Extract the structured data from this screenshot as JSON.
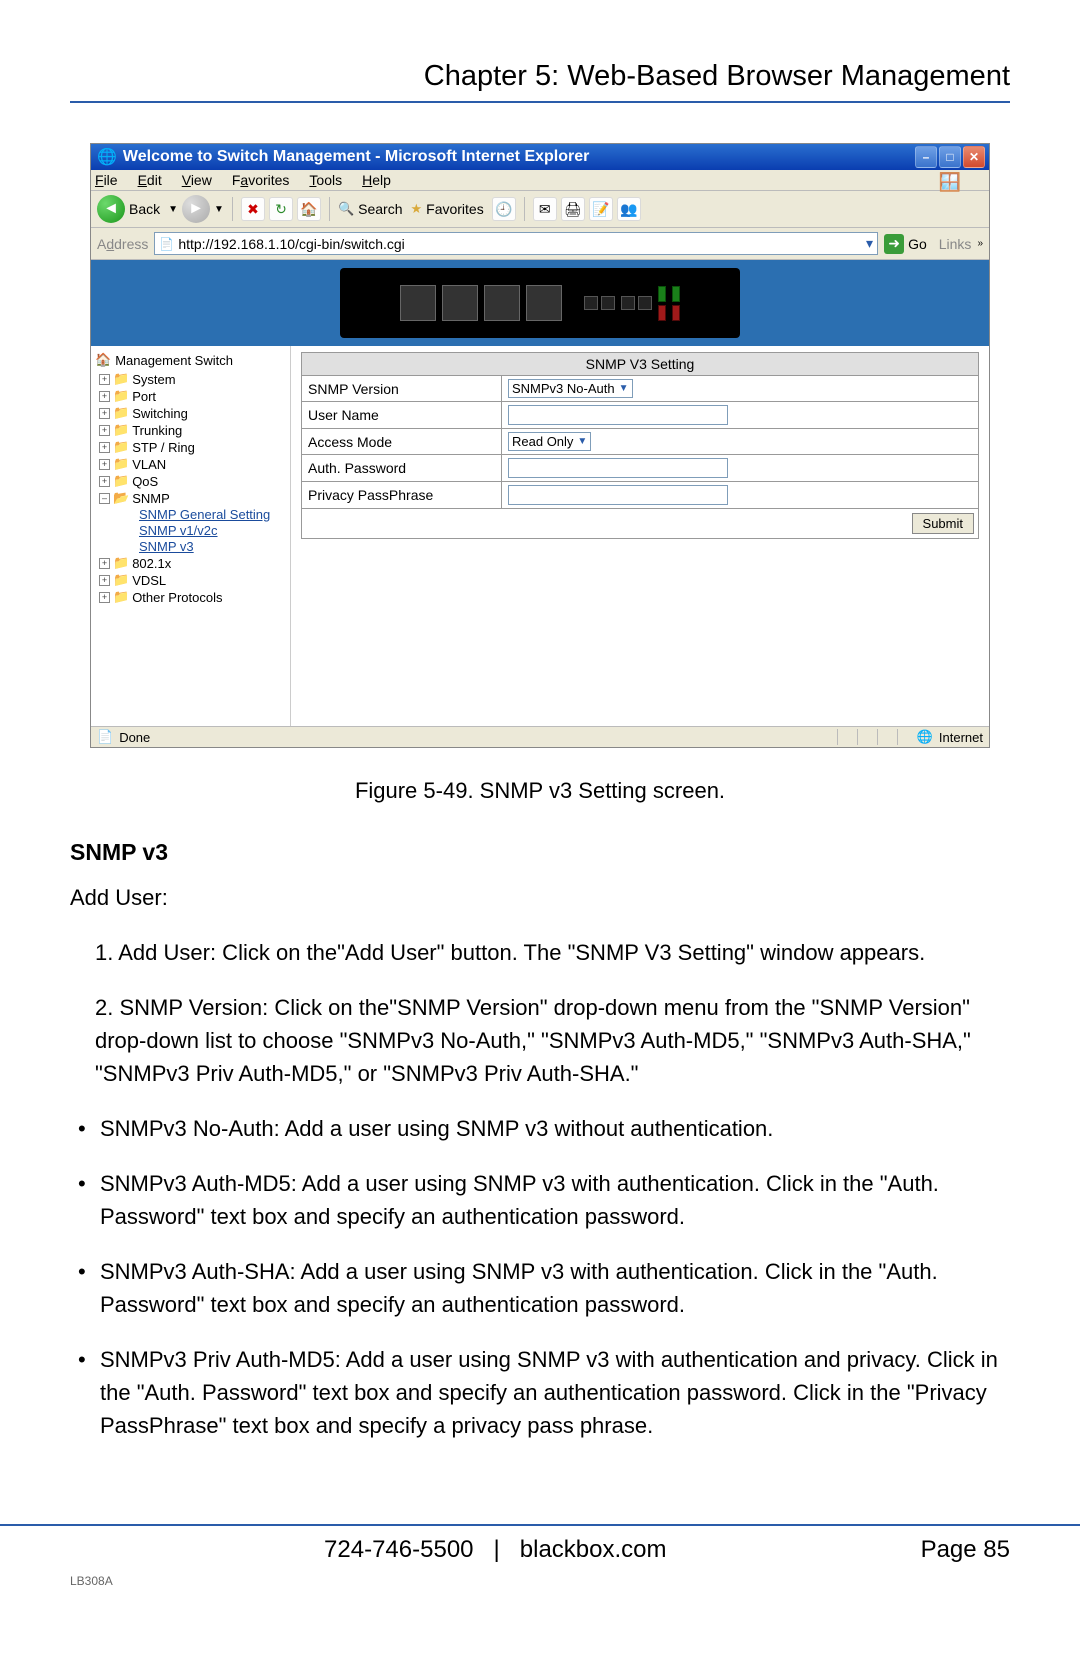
{
  "chapter_title": "Chapter 5: Web-Based Browser Management",
  "browser": {
    "title": "Welcome to Switch Management - Microsoft Internet Explorer",
    "menu": [
      "File",
      "Edit",
      "View",
      "Favorites",
      "Tools",
      "Help"
    ],
    "back_label": "Back",
    "search_label": "Search",
    "favorites_label": "Favorites",
    "address_label": "Address",
    "url": "http://192.168.1.10/cgi-bin/switch.cgi",
    "go_label": "Go",
    "links_label": "Links",
    "status_done": "Done",
    "status_zone": "Internet"
  },
  "tree": {
    "root": "Management Switch",
    "items": [
      "System",
      "Port",
      "Switching",
      "Trunking",
      "STP / Ring",
      "VLAN",
      "QoS"
    ],
    "snmp": "SNMP",
    "snmp_children": [
      "SNMP General Setting",
      "SNMP v1/v2c",
      "SNMP v3"
    ],
    "items_after": [
      "802.1x",
      "VDSL",
      "Other Protocols"
    ]
  },
  "form": {
    "heading": "SNMP V3 Setting",
    "rows": {
      "snmp_version": "SNMP Version",
      "snmp_version_value": "SNMPv3 No-Auth",
      "user_name": "User Name",
      "access_mode": "Access Mode",
      "access_mode_value": "Read Only",
      "auth_password": "Auth. Password",
      "privacy_passphrase": "Privacy PassPhrase"
    },
    "submit": "Submit"
  },
  "figure_caption": "Figure 5-49. SNMP v3 Setting screen.",
  "section_heading": "SNMP v3",
  "add_user_label": "Add User:",
  "step1": "1. Add User: Click on the\"Add User\" button. The \"SNMP V3 Setting\" window appears.",
  "step2": "2. SNMP Version: Click on the\"SNMP Version\" drop-down menu from the \"SNMP Version\" drop-down list to choose \"SNMPv3 No-Auth,\" \"SNMPv3 Auth-MD5,\" \"SNMPv3 Auth-SHA,\" \"SNMPv3 Priv Auth-MD5,\" or \"SNMPv3 Priv Auth-SHA.\"",
  "bullet1": "SNMPv3 No-Auth: Add a user using SNMP v3 without authentication.",
  "bullet2": "SNMPv3 Auth-MD5: Add a user using SNMP v3 with authentication. Click in the \"Auth. Password\" text box and specify an authentication password.",
  "bullet3": "SNMPv3 Auth-SHA: Add a user using SNMP v3 with authentication. Click in the \"Auth. Password\" text box and specify an authentication password.",
  "bullet4": "SNMPv3 Priv Auth-MD5: Add a user using SNMP v3 with authentication and privacy. Click in the \"Auth. Password\" text box and specify an authentication password. Click in the \"Privacy PassPhrase\" text box and specify a privacy pass phrase.",
  "footer": {
    "phone": "724-746-5500",
    "sep": "|",
    "site": "blackbox.com",
    "page": "Page 85",
    "code": "LB308A"
  }
}
